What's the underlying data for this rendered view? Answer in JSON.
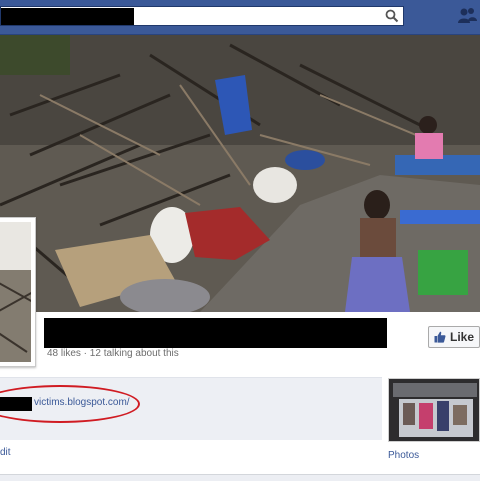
{
  "topbar": {
    "search_value": "",
    "search_icon": "search-icon",
    "friends_icon": "friend-requests-icon",
    "color": "#3b5998"
  },
  "page": {
    "stats_text": "48 likes · 12 talking about this",
    "like_label": "Like",
    "about_url": "victims.blogspot.com/",
    "edit_label": "dit",
    "photos_label": "Photos"
  },
  "colors": {
    "highlight": "#d01b22",
    "link": "#3b5998"
  }
}
